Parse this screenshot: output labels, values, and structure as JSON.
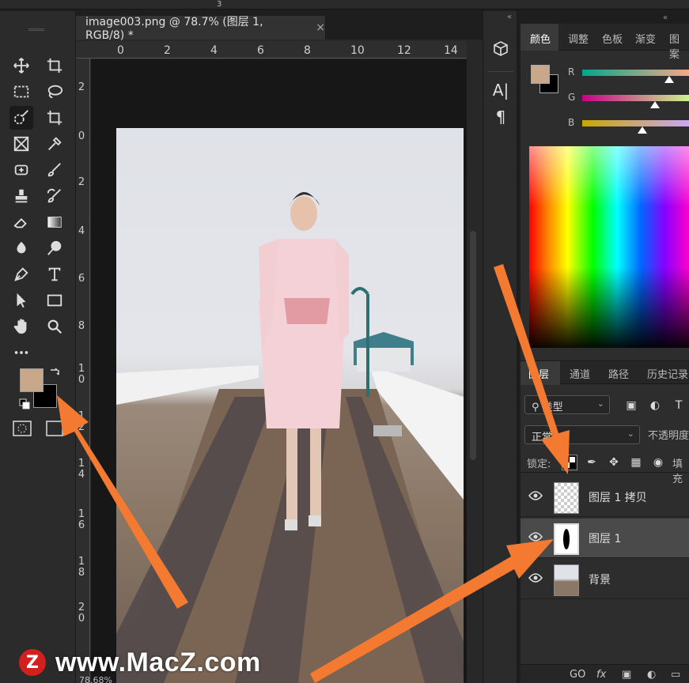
{
  "colors": {
    "foreground": "#c9a78a",
    "background": "#000000",
    "arrow": "#f37a30",
    "watermark_logo": "#d2201e"
  },
  "topbar": {
    "number": "3"
  },
  "document": {
    "tab_title": "image003.png @ 78.7% (图层 1, RGB/8) *",
    "close_glyph": "×",
    "zoom_status": "78.68%",
    "ruler_top_labels": [
      "0",
      "2",
      "4",
      "6",
      "8",
      "10",
      "12",
      "14"
    ],
    "ruler_left_labels": [
      "2",
      "0",
      "2",
      "4",
      "6",
      "8",
      "10",
      "12",
      "14",
      "16",
      "18",
      "20"
    ]
  },
  "tools": [
    {
      "name": "move-tool-icon"
    },
    {
      "name": "artboard-tool-icon"
    },
    {
      "name": "marquee-tool-icon"
    },
    {
      "name": "lasso-tool-icon"
    },
    {
      "name": "quick-selection-tool-icon"
    },
    {
      "name": "crop-tool-icon"
    },
    {
      "name": "frame-tool-icon"
    },
    {
      "name": "eyedropper-tool-icon"
    },
    {
      "name": "healing-brush-tool-icon"
    },
    {
      "name": "brush-tool-icon"
    },
    {
      "name": "clone-stamp-tool-icon"
    },
    {
      "name": "history-brush-tool-icon"
    },
    {
      "name": "eraser-tool-icon"
    },
    {
      "name": "gradient-tool-icon"
    },
    {
      "name": "blur-tool-icon"
    },
    {
      "name": "dodge-tool-icon"
    },
    {
      "name": "pen-tool-icon"
    },
    {
      "name": "type-tool-icon"
    },
    {
      "name": "path-selection-tool-icon"
    },
    {
      "name": "rectangle-tool-icon"
    },
    {
      "name": "hand-tool-icon"
    },
    {
      "name": "zoom-tool-icon"
    },
    {
      "name": "more-tools-icon"
    }
  ],
  "mid_panel": {
    "collapse": "«",
    "items": [
      "3d-icon",
      "character-icon",
      "paragraph-icon"
    ],
    "character_glyph": "A|",
    "paragraph_glyph": "¶"
  },
  "color_panel": {
    "collapse": "«",
    "tabs": [
      "颜色",
      "调整",
      "色板",
      "渐变",
      "图案"
    ],
    "sliders": [
      {
        "label": "R",
        "value": 201
      },
      {
        "label": "G",
        "value": 167
      },
      {
        "label": "B",
        "value": 138
      }
    ]
  },
  "layers_panel": {
    "tabs": [
      "图层",
      "通道",
      "路径",
      "历史记录"
    ],
    "filter_label": "类型",
    "blend_mode": "正常",
    "opacity_label": "不透明度",
    "lock_label": "锁定:",
    "fill_label": "填充",
    "layers": [
      {
        "name": "图层 1 拷贝",
        "selected": false
      },
      {
        "name": "图层 1",
        "selected": true
      },
      {
        "name": "背景",
        "selected": false
      }
    ],
    "bottom_icons": [
      "GO",
      "fx"
    ]
  },
  "watermark": {
    "logo_letter": "Z",
    "text": "www.MacZ.com"
  }
}
